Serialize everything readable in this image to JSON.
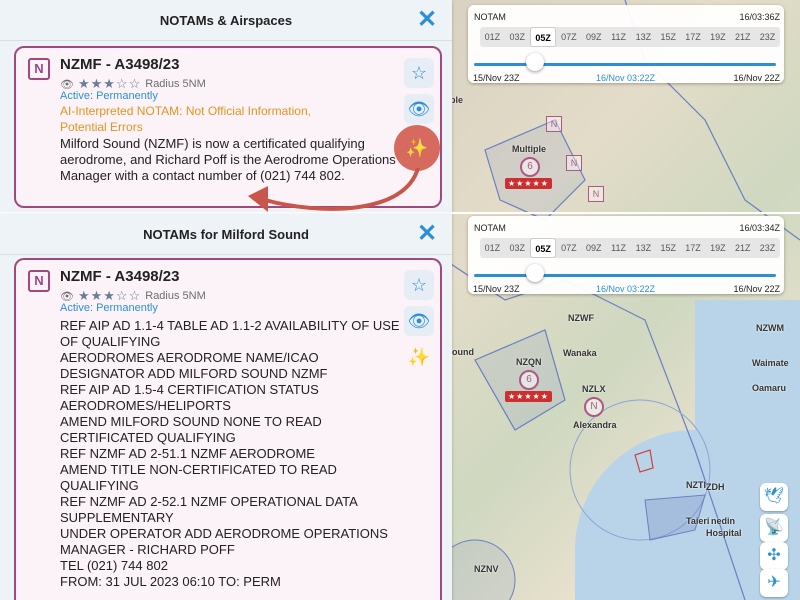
{
  "top_panel": {
    "title": "NOTAMs & Airspaces",
    "close": "✕"
  },
  "bottom_panel": {
    "title": "NOTAMs for Milford Sound",
    "close": "✕"
  },
  "notam": {
    "badge": "N",
    "id": "NZMF - A3498/23",
    "stars": "★★★☆☆",
    "radius": "Radius 5NM",
    "active": "Active: Permanently",
    "ai_warning": "AI-Interpreted NOTAM: Not Official Information, Potential Errors",
    "ai_summary": "Milford Sound (NZMF) is now a certificated qualifying aerodrome, and Richard Poff is the Aerodrome Operations Manager with a contact number of (021) 744 802.",
    "raw_text": "REF AIP AD 1.1-4 TABLE AD 1.1-2 AVAILABILITY OF USE OF QUALIFYING\nAERODROMES AERODROME NAME/ICAO DESIGNATOR ADD MILFORD SOUND NZMF\nREF AIP AD 1.5-4 CERTIFICATION STATUS AERODROMES/HELIPORTS\nAMEND MILFORD SOUND NONE TO READ CERTIFICATED QUALIFYING\nREF NZMF AD 2-51.1 NZMF AERODROME\nAMEND TITLE NON-CERTIFICATED TO READ QUALIFYING\nREF NZMF AD 2-52.1 NZMF OPERATIONAL DATA SUPPLEMENTARY\nUNDER OPERATOR ADD AERODROME OPERATIONS MANAGER - RICHARD POFF\nTEL (021) 744 802\nFROM: 31 JUL 2023 06:10 TO: PERM"
  },
  "timebar_top": {
    "label": "NOTAM",
    "current": "16/03:36Z",
    "hours": [
      "01Z",
      "03Z",
      "05Z",
      "07Z",
      "09Z",
      "11Z",
      "13Z",
      "15Z",
      "17Z",
      "19Z",
      "21Z",
      "23Z"
    ],
    "selected": "05Z",
    "start": "15/Nov 23Z",
    "mid": "16/Nov 03:22Z",
    "end": "16/Nov 22Z"
  },
  "timebar_bottom": {
    "label": "NOTAM",
    "current": "16/03:34Z",
    "hours": [
      "01Z",
      "03Z",
      "05Z",
      "07Z",
      "09Z",
      "11Z",
      "13Z",
      "15Z",
      "17Z",
      "19Z",
      "21Z",
      "23Z"
    ],
    "selected": "05Z",
    "start": "15/Nov 23Z",
    "mid": "16/Nov 03:22Z",
    "end": "16/Nov 22Z"
  },
  "map_top": {
    "multiple": "Multiple",
    "count": "6",
    "rating": "★★★★★",
    "badge": "N",
    "ple": "ple"
  },
  "map_bottom": {
    "nzwf": "NZWF",
    "wanaka": "Wanaka",
    "nzqn": "NZQN",
    "count": "6",
    "rating": "★★★★★",
    "nzlx": "NZLX",
    "alexandra": "Alexandra",
    "nzwm": "NZWM",
    "waimate": "Waimate",
    "oamaru": "Oamaru",
    "nzti": "NZTI",
    "taieri": "Taieri",
    "nzdh": "ZDH",
    "dunedin": "nedin",
    "hospital": "Hospital",
    "nznv": "NZNV",
    "sound": "ound"
  }
}
